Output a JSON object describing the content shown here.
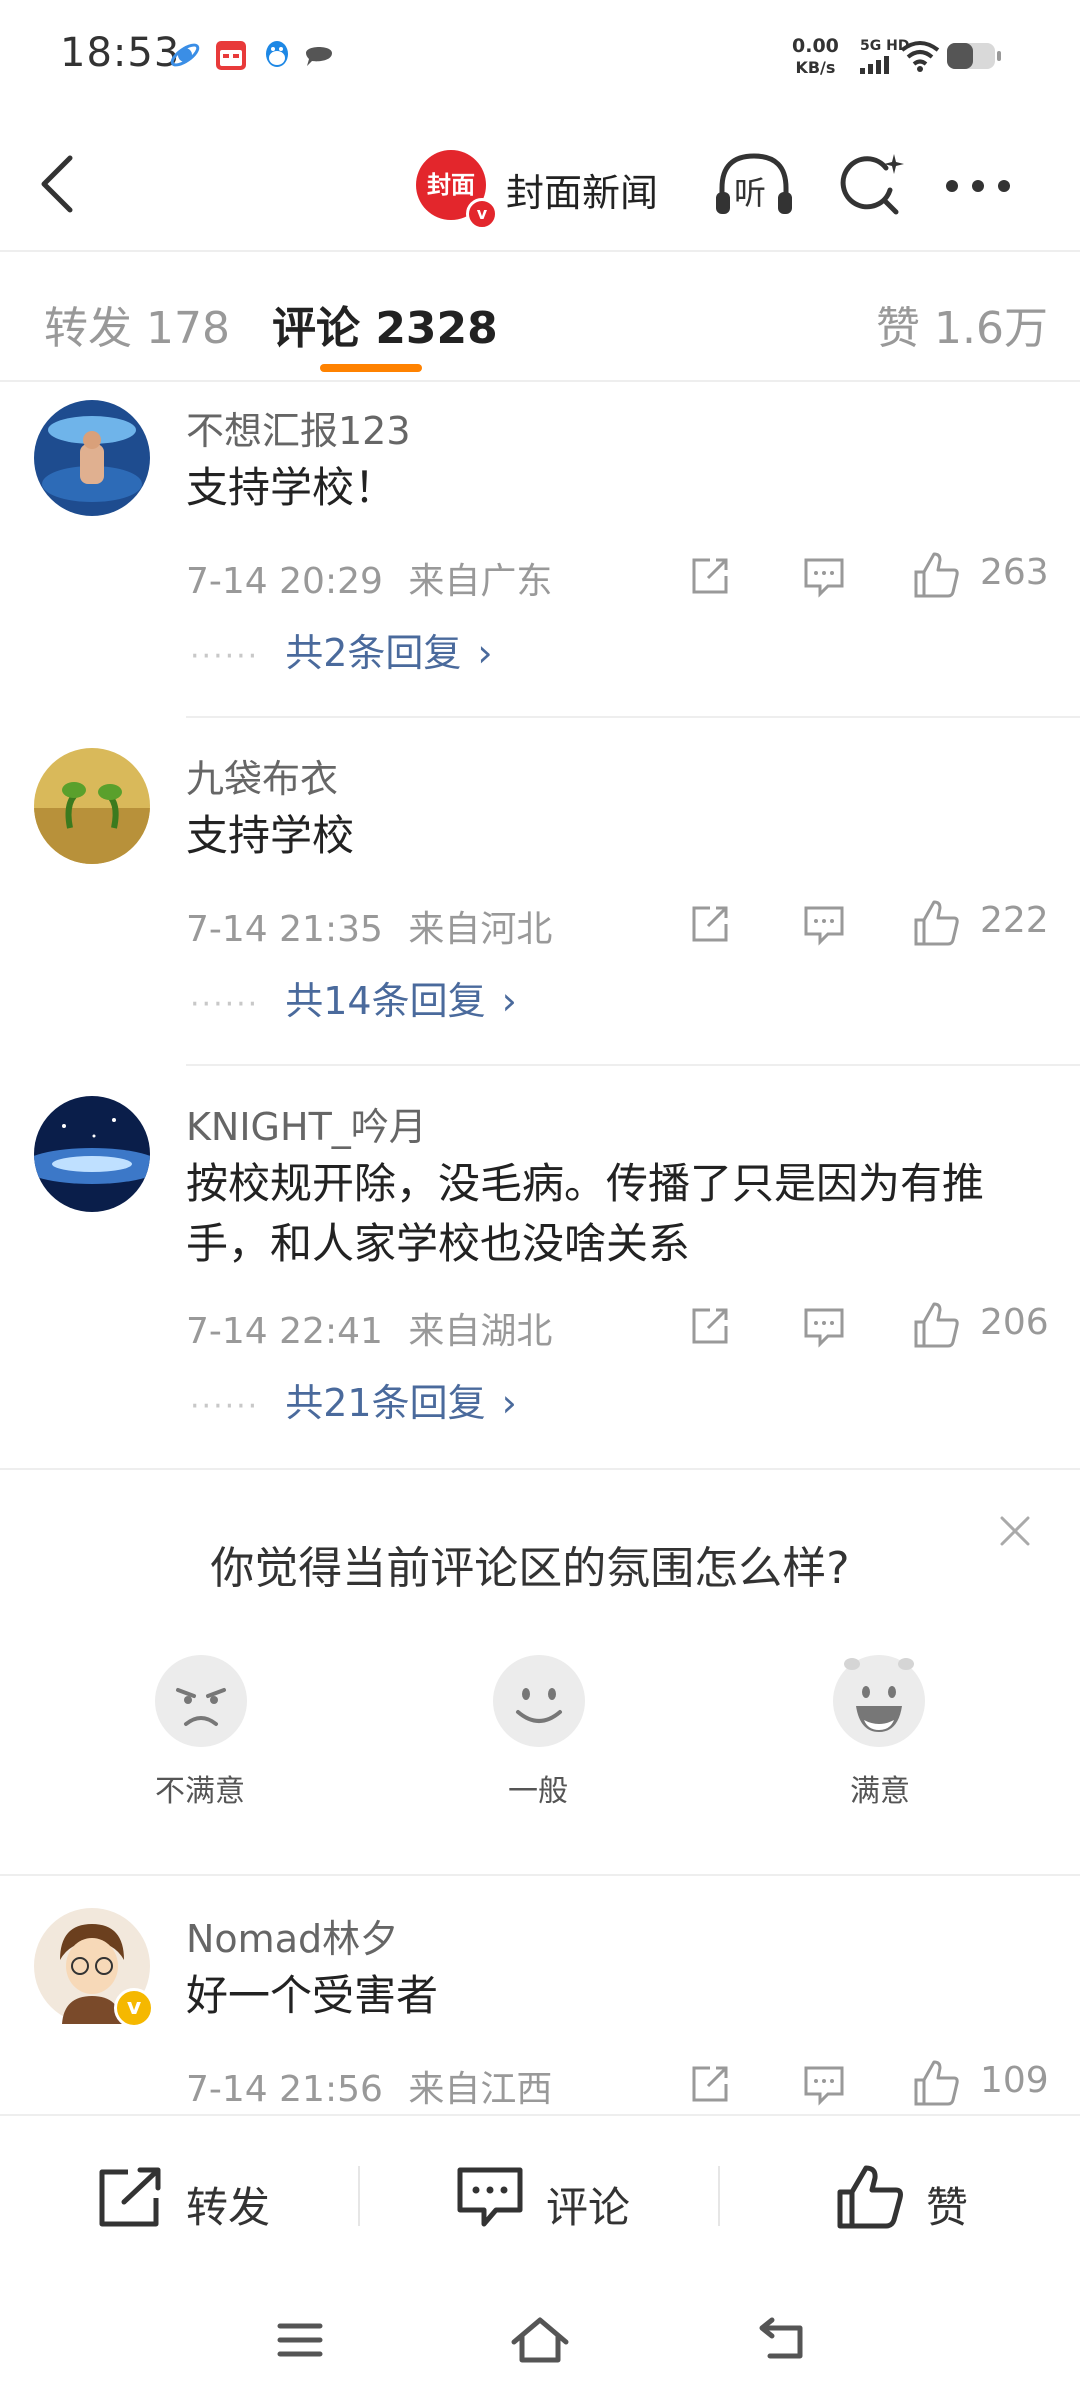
{
  "status": {
    "time": "18:53",
    "net_speed_value": "0.00",
    "net_speed_unit": "KB/s",
    "network": "5G HD",
    "icons": [
      "planet-app-icon",
      "calendar-app-icon",
      "qq-app-icon",
      "chat-app-icon",
      "signal-icon",
      "wifi-icon",
      "battery-icon"
    ]
  },
  "header": {
    "back_icon": "back-icon",
    "brand_logo_text": "封面",
    "verified_mark": "v",
    "brand_name": "封面新闻",
    "listen_label": "听",
    "search_icon": "search-icon",
    "more_icon": "more-icon"
  },
  "tabs": {
    "repost": "转发 178",
    "comments": "评论 2328",
    "likes": "赞 1.6万",
    "active": "comments",
    "accent_color": "#ff8200"
  },
  "comments": [
    {
      "user": "不想汇报123",
      "text": "支持学校！",
      "time": "7-14 20:29",
      "location": "来自广东",
      "likes": "263",
      "replies_label": "共2条回复"
    },
    {
      "user": "九袋布衣",
      "text": "支持学校",
      "time": "7-14 21:35",
      "location": "来自河北",
      "likes": "222",
      "replies_label": "共14条回复"
    },
    {
      "user": "KNIGHT_吟月",
      "text": "按校规开除，没毛病。传播了只是因为有推手，和人家学校也没啥关系",
      "time": "7-14 22:41",
      "location": "来自湖北",
      "likes": "206",
      "replies_label": "共21条回复"
    },
    {
      "user": "Nomad林夕",
      "text": "好一个受害者",
      "time": "7-14 21:56",
      "location": "来自江西",
      "likes": "109",
      "verified_badge_color": "#f5b800"
    }
  ],
  "survey": {
    "question": "你觉得当前评论区的氛围怎么样?",
    "options": [
      "不满意",
      "一般",
      "满意"
    ]
  },
  "bottom_bar": {
    "repost": "转发",
    "comment": "评论",
    "like": "赞"
  },
  "nav": {
    "icons": [
      "menu-icon",
      "home-icon",
      "back-nav-icon"
    ]
  }
}
